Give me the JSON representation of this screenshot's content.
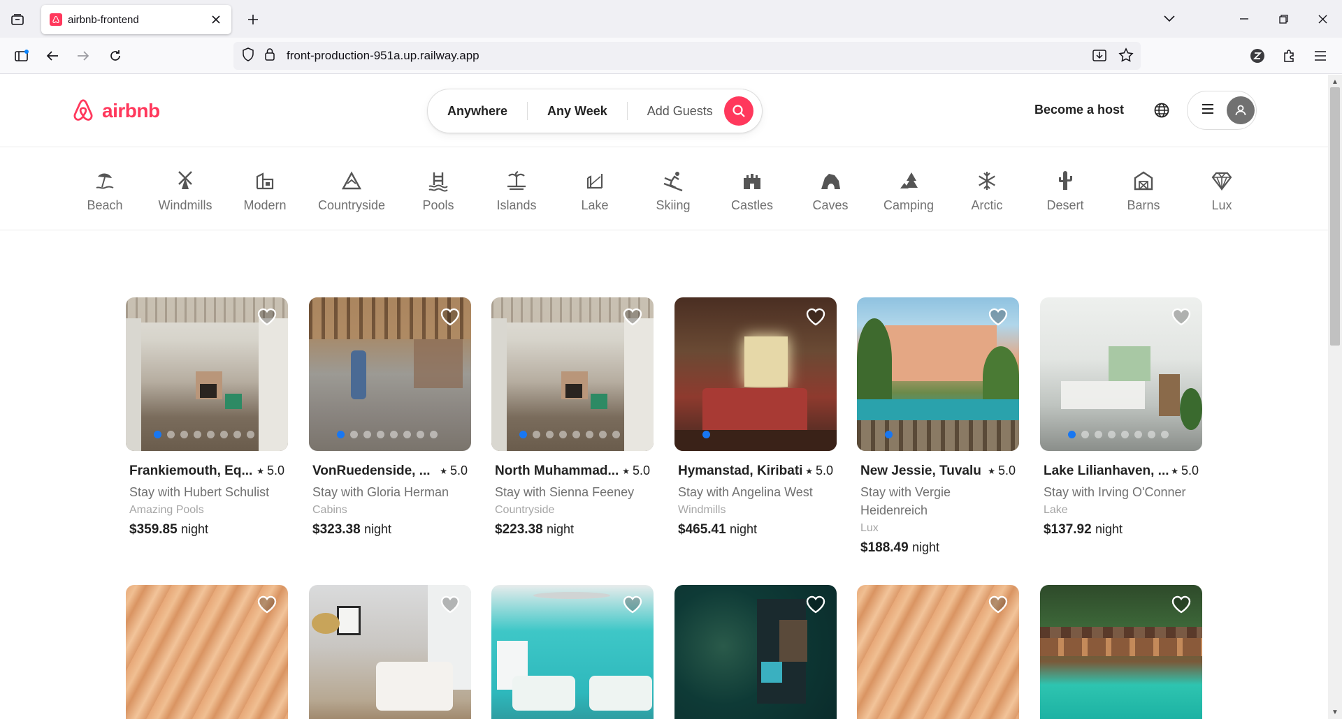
{
  "browser": {
    "tab_title": "airbnb-frontend",
    "url": "front-production-951a.up.railway.app"
  },
  "header": {
    "logo_text": "airbnb",
    "search": {
      "anywhere": "Anywhere",
      "any_week": "Any Week",
      "add_guests": "Add Guests"
    },
    "become_host": "Become a host"
  },
  "categories": [
    {
      "label": "Beach",
      "icon": "beach-icon"
    },
    {
      "label": "Windmills",
      "icon": "windmill-icon"
    },
    {
      "label": "Modern",
      "icon": "modern-icon"
    },
    {
      "label": "Countryside",
      "icon": "countryside-icon"
    },
    {
      "label": "Pools",
      "icon": "pool-icon"
    },
    {
      "label": "Islands",
      "icon": "island-icon"
    },
    {
      "label": "Lake",
      "icon": "lake-icon"
    },
    {
      "label": "Skiing",
      "icon": "skiing-icon"
    },
    {
      "label": "Castles",
      "icon": "castle-icon"
    },
    {
      "label": "Caves",
      "icon": "cave-icon"
    },
    {
      "label": "Camping",
      "icon": "camping-icon"
    },
    {
      "label": "Arctic",
      "icon": "snowflake-icon"
    },
    {
      "label": "Desert",
      "icon": "cactus-icon"
    },
    {
      "label": "Barns",
      "icon": "barn-icon"
    },
    {
      "label": "Lux",
      "icon": "diamond-icon"
    }
  ],
  "listings": [
    {
      "location": "Frankiemouth, Eq...",
      "rating": "5.0",
      "host": "Stay with Hubert Schulist",
      "category": "Amazing Pools",
      "price": "$359.85",
      "unit": "night"
    },
    {
      "location": "VonRuedenside, ...",
      "rating": "5.0",
      "host": "Stay with Gloria Herman",
      "category": "Cabins",
      "price": "$323.38",
      "unit": "night"
    },
    {
      "location": "North Muhammad...",
      "rating": "5.0",
      "host": "Stay with Sienna Feeney",
      "category": "Countryside",
      "price": "$223.38",
      "unit": "night"
    },
    {
      "location": "Hymanstad, Kiribati",
      "rating": "5.0",
      "host": "Stay with Angelina West",
      "category": "Windmills",
      "price": "$465.41",
      "unit": "night"
    },
    {
      "location": "New Jessie, Tuvalu",
      "rating": "5.0",
      "host": "Stay with Vergie Heidenreich",
      "category": "Lux",
      "price": "$188.49",
      "unit": "night"
    },
    {
      "location": "Lake Lilianhaven, ...",
      "rating": "5.0",
      "host": "Stay with Irving O'Conner",
      "category": "Lake",
      "price": "$137.92",
      "unit": "night"
    }
  ],
  "colors": {
    "brand": "#ff385c",
    "text": "#222222",
    "muted": "#717171",
    "dot_active": "#1877f2"
  }
}
